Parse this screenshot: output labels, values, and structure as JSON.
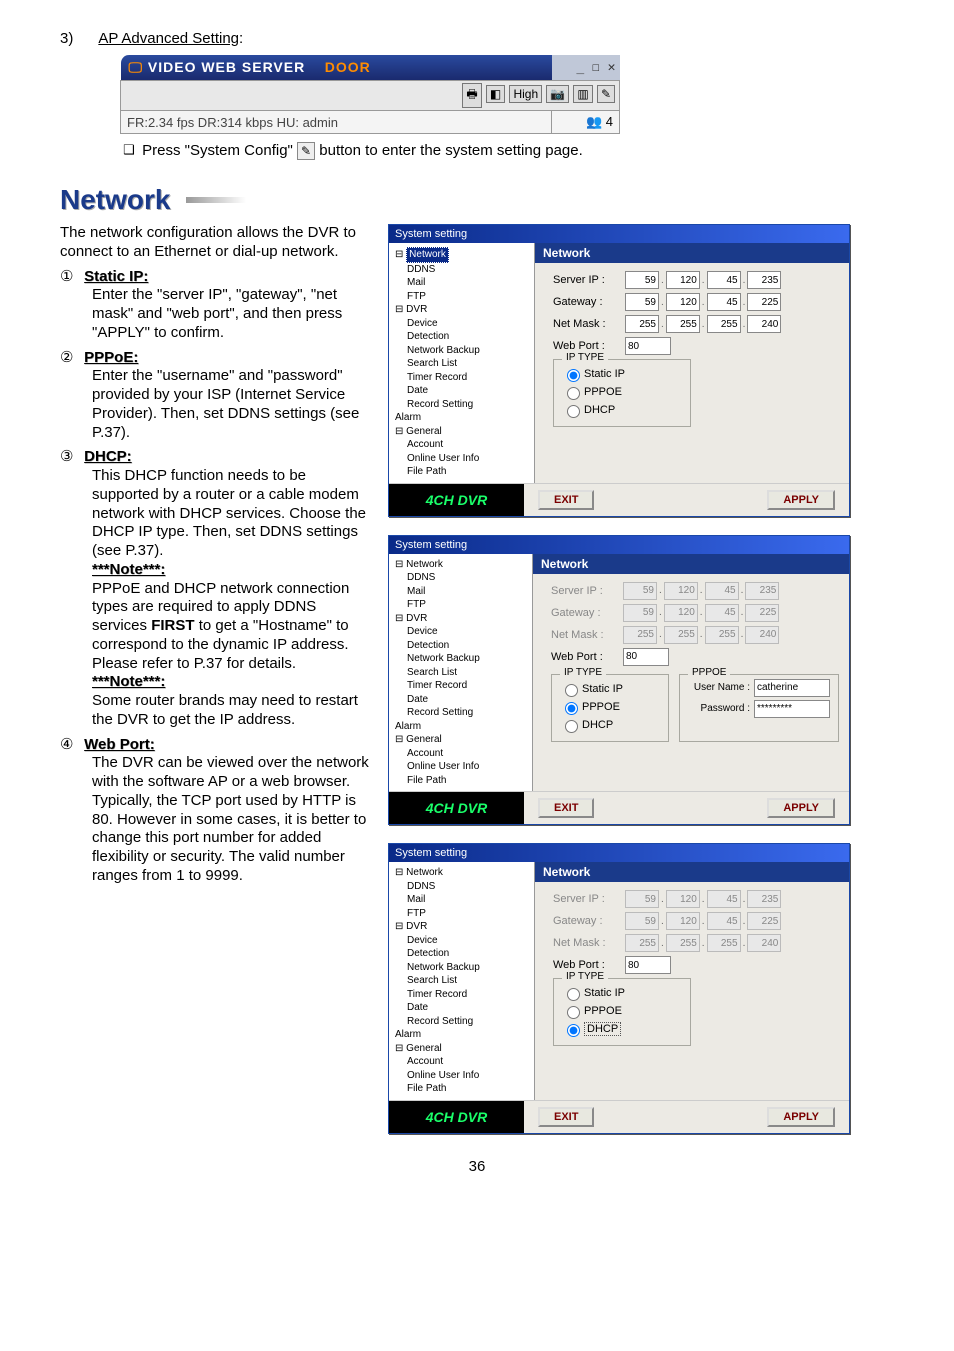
{
  "page_number": "36",
  "header": {
    "num": "3)",
    "title": "AP Advanced Setting",
    "colon": ":"
  },
  "topbar": {
    "title_left": "VIDEO WEB SERVER",
    "title_right": "DOOR",
    "winbtns": "_ ☐ ✕",
    "status": "FR:2.34 fps DR:314 kbps   HU: admin",
    "status_right": "4",
    "icon_high": "High"
  },
  "press_line": {
    "bullet": "❑",
    "pre": "Press \"System Config\"",
    "post": " button to enter the system setting page."
  },
  "h1": "Network",
  "intro": "The network configuration allows the DVR to connect to an Ethernet or dial-up network.",
  "items": {
    "static": {
      "num": "①",
      "title": "Static IP:",
      "body": "Enter the \"server IP\", \"gateway\", \"net mask\" and \"web port\", and then press \"APPLY\" to confirm."
    },
    "pppoe": {
      "num": "②",
      "title": "PPPoE:",
      "body": "Enter the \"username\" and \"password\" provided by your ISP (Internet Service Provider). Then, set DDNS settings (see P.37)."
    },
    "dhcp": {
      "num": "③",
      "title": "DHCP:",
      "body1": "This DHCP function needs to be supported by a router or a cable modem network with DHCP services. Choose the DHCP IP type. Then, set DDNS settings (see P.37).",
      "note_t": "***Note***:",
      "note1a": "PPPoE and DHCP network connection types are required to apply DDNS services ",
      "note1b": "FIRST",
      "note1c": " to get a \"Hostname\" to correspond to the dynamic IP address.",
      "note1d": "Please refer to P.37 for details.",
      "note2": "Some router brands may need to restart the DVR to get the IP address."
    },
    "webport": {
      "num": "④",
      "title": "Web Port:",
      "body": "The DVR can be viewed over the network with the software AP or a web browser. Typically, the TCP port used by HTTP is 80. However in some cases, it is better to change this port number for added flexibility or security. The valid number ranges from 1 to 9999."
    }
  },
  "tree": {
    "network": "Network",
    "ddns": "DDNS",
    "mail": "Mail",
    "ftp": "FTP",
    "dvr": "DVR",
    "device": "Device",
    "detection": "Detection",
    "nbackup": "Network Backup",
    "slist": "Search List",
    "trecord": "Timer Record",
    "date": "Date",
    "rsetting": "Record Setting",
    "alarm": "Alarm",
    "general": "General",
    "account": "Account",
    "oui": "Online User Info",
    "fpath": "File Path"
  },
  "panel": {
    "title": "Network",
    "serverip": "Server IP :",
    "gateway": "Gateway :",
    "netmask": "Net Mask :",
    "webport": "Web Port :",
    "iptype": "IP TYPE",
    "static": "Static IP",
    "pppoe": "PPPOE",
    "dhcp": "DHCP",
    "pppoe_legend": "PPPOE",
    "username": "User Name :",
    "password": "Password :",
    "user_val": "catherine",
    "pass_val": "*********",
    "webport_val": "80",
    "ip": {
      "a": "59",
      "b": "120",
      "c": "45",
      "d": "235"
    },
    "gw": {
      "a": "59",
      "b": "120",
      "c": "45",
      "d": "225"
    },
    "nm": {
      "a": "255",
      "b": "255",
      "c": "255",
      "d": "240"
    }
  },
  "brand": "4CH DVR",
  "btn": {
    "exit": "EXIT",
    "apply": "APPLY"
  },
  "wintitle": "System setting"
}
